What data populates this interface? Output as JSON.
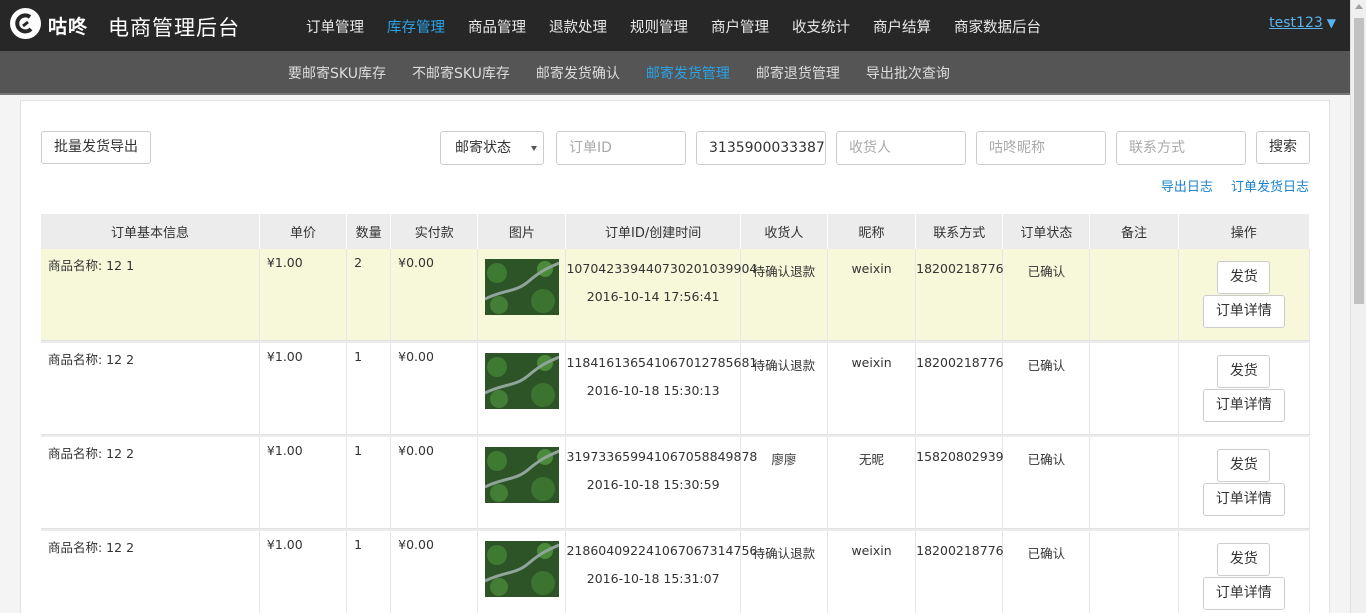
{
  "brand": {
    "logo_text": "咕咚",
    "app_title": "电商管理后台"
  },
  "main_nav": [
    {
      "label": "订单管理",
      "active": false
    },
    {
      "label": "库存管理",
      "active": true
    },
    {
      "label": "商品管理",
      "active": false
    },
    {
      "label": "退款处理",
      "active": false
    },
    {
      "label": "规则管理",
      "active": false
    },
    {
      "label": "商户管理",
      "active": false
    },
    {
      "label": "收支统计",
      "active": false
    },
    {
      "label": "商户结算",
      "active": false
    },
    {
      "label": "商家数据后台",
      "active": false
    }
  ],
  "user": {
    "name": "test123",
    "caret": "▼"
  },
  "sub_nav": [
    {
      "label": "要邮寄SKU库存",
      "active": false
    },
    {
      "label": "不邮寄SKU库存",
      "active": false
    },
    {
      "label": "邮寄发货确认",
      "active": false
    },
    {
      "label": "邮寄发货管理",
      "active": true
    },
    {
      "label": "邮寄退货管理",
      "active": false
    },
    {
      "label": "导出批次查询",
      "active": false
    }
  ],
  "toolbar": {
    "export_label": "批量发货导出",
    "status_select": "邮寄状态",
    "order_id_placeholder": "订单ID",
    "search_value": "3135900033387",
    "receiver_placeholder": "收货人",
    "nickname_placeholder": "咕咚昵称",
    "contact_placeholder": "联系方式",
    "search_label": "搜索",
    "export_log": "导出日志",
    "ship_log": "订单发货日志"
  },
  "table": {
    "columns": [
      "订单基本信息",
      "单价",
      "数量",
      "实付款",
      "图片",
      "订单ID/创建时间",
      "收货人",
      "昵称",
      "联系方式",
      "订单状态",
      "备注",
      "操作"
    ],
    "rows": [
      {
        "name": "商品名称: 12 1",
        "price": "¥1.00",
        "qty": "2",
        "paid": "¥0.00",
        "order_id": "10704233944073020103990 4",
        "created": "2016-10-14 17:56:41",
        "receiver": "待确认退款",
        "nickname": "weixin",
        "contact": "18200218776",
        "status": "已确认",
        "note": "",
        "highlight": true
      },
      {
        "name": "商品名称: 12 2",
        "price": "¥1.00",
        "qty": "1",
        "paid": "¥0.00",
        "order_id": "11841613654106701278568 1",
        "created": "2016-10-18 15:30:13",
        "receiver": "待确认退款",
        "nickname": "weixin",
        "contact": "18200218776",
        "status": "已确认",
        "note": "",
        "highlight": false
      },
      {
        "name": "商品名称: 12 2",
        "price": "¥1.00",
        "qty": "1",
        "paid": "¥0.00",
        "order_id": "31973365994106705884987 8",
        "created": "2016-10-18 15:30:59",
        "receiver": "廖廖",
        "nickname": "无昵",
        "contact": "15820802939",
        "status": "已确认",
        "note": "",
        "highlight": false
      },
      {
        "name": "商品名称: 12 2",
        "price": "¥1.00",
        "qty": "1",
        "paid": "¥0.00",
        "order_id": "21860409224106706731475 6",
        "created": "2016-10-18 15:31:07",
        "receiver": "待确认退款",
        "nickname": "weixin",
        "contact": "18200218776",
        "status": "已确认",
        "note": "",
        "highlight": false
      }
    ],
    "ship_label": "发货",
    "detail_label": "订单详情"
  },
  "colors": {
    "topbar": "#272727",
    "subbar": "#555555",
    "accent": "#2aa3e8",
    "link": "#1a82c8",
    "highlight_row": "#f7f8d9"
  }
}
